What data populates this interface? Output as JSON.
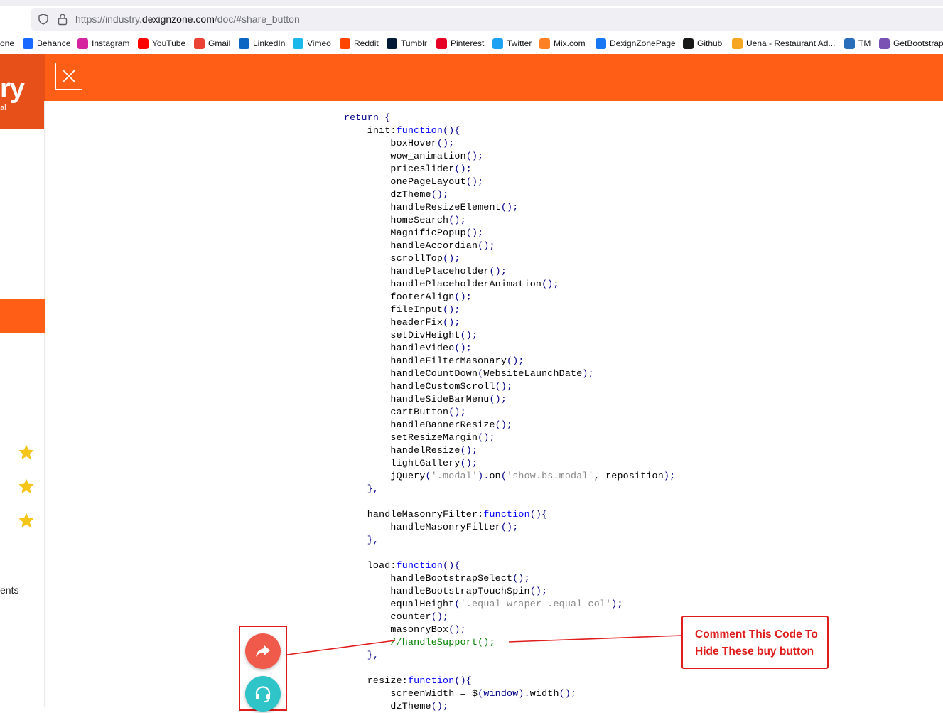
{
  "browser": {
    "url_prefix": "https://industry.",
    "url_domain": "dexignzone.com",
    "url_path": "/doc/#share_button"
  },
  "bookmarks": [
    {
      "label": "one",
      "icon": "none",
      "color": ""
    },
    {
      "label": "Behance",
      "icon": "behance-icon",
      "color": "#1769ff"
    },
    {
      "label": "Instagram",
      "icon": "instagram-icon",
      "color": "#d6249f"
    },
    {
      "label": "YouTube",
      "icon": "youtube-icon",
      "color": "#ff0000"
    },
    {
      "label": "Gmail",
      "icon": "gmail-icon",
      "color": "#ea4335"
    },
    {
      "label": "LinkedIn",
      "icon": "linkedin-icon",
      "color": "#0a66c2"
    },
    {
      "label": "Vimeo",
      "icon": "vimeo-icon",
      "color": "#1ab7ea"
    },
    {
      "label": "Reddit",
      "icon": "reddit-icon",
      "color": "#ff4500"
    },
    {
      "label": "Tumblr",
      "icon": "tumblr-icon",
      "color": "#001935"
    },
    {
      "label": "Pinterest",
      "icon": "pinterest-icon",
      "color": "#e60023"
    },
    {
      "label": "Twitter",
      "icon": "twitter-icon",
      "color": "#1da1f2"
    },
    {
      "label": "Mix.com",
      "icon": "mix-icon",
      "color": "#ff8126"
    },
    {
      "label": "DexignZonePage",
      "icon": "facebook-icon",
      "color": "#1877f2"
    },
    {
      "label": "Github",
      "icon": "github-icon",
      "color": "#181717"
    },
    {
      "label": "Uena - Restaurant Ad...",
      "icon": "uena-icon",
      "color": "#f6a623"
    },
    {
      "label": "TM",
      "icon": "tm-icon",
      "color": "#2a6ebb"
    },
    {
      "label": "GetBootstrap",
      "icon": "bootstrap-icon",
      "color": "#7952b3"
    }
  ],
  "sidebar": {
    "logo_text": "ry",
    "logo_sub": "al",
    "bottom_text": "ents"
  },
  "code_lines": [
    [
      {
        "t": "return",
        "c": "ret"
      },
      {
        "t": " {",
        "c": "pn"
      }
    ],
    [
      {
        "t": "    init:",
        "c": ""
      },
      {
        "t": "function",
        "c": "kw"
      },
      {
        "t": "(){",
        "c": "pn"
      }
    ],
    [
      {
        "t": "        boxHover",
        "c": ""
      },
      {
        "t": "();",
        "c": "pn"
      }
    ],
    [
      {
        "t": "        wow_animation",
        "c": ""
      },
      {
        "t": "();",
        "c": "pn"
      }
    ],
    [
      {
        "t": "        priceslider",
        "c": ""
      },
      {
        "t": "();",
        "c": "pn"
      }
    ],
    [
      {
        "t": "        onePageLayout",
        "c": ""
      },
      {
        "t": "();",
        "c": "pn"
      }
    ],
    [
      {
        "t": "        dzTheme",
        "c": ""
      },
      {
        "t": "();",
        "c": "pn"
      }
    ],
    [
      {
        "t": "        handleResizeElement",
        "c": ""
      },
      {
        "t": "();",
        "c": "pn"
      }
    ],
    [
      {
        "t": "        homeSearch",
        "c": ""
      },
      {
        "t": "();",
        "c": "pn"
      }
    ],
    [
      {
        "t": "        MagnificPopup",
        "c": ""
      },
      {
        "t": "();",
        "c": "pn"
      }
    ],
    [
      {
        "t": "        handleAccordian",
        "c": ""
      },
      {
        "t": "();",
        "c": "pn"
      }
    ],
    [
      {
        "t": "        scrollTop",
        "c": ""
      },
      {
        "t": "();",
        "c": "pn"
      }
    ],
    [
      {
        "t": "        handlePlaceholder",
        "c": ""
      },
      {
        "t": "();",
        "c": "pn"
      }
    ],
    [
      {
        "t": "        handlePlaceholderAnimation",
        "c": ""
      },
      {
        "t": "();",
        "c": "pn"
      }
    ],
    [
      {
        "t": "        footerAlign",
        "c": ""
      },
      {
        "t": "();",
        "c": "pn"
      }
    ],
    [
      {
        "t": "        fileInput",
        "c": ""
      },
      {
        "t": "();",
        "c": "pn"
      }
    ],
    [
      {
        "t": "        headerFix",
        "c": ""
      },
      {
        "t": "();",
        "c": "pn"
      }
    ],
    [
      {
        "t": "        setDivHeight",
        "c": ""
      },
      {
        "t": "();",
        "c": "pn"
      }
    ],
    [
      {
        "t": "        handleVideo",
        "c": ""
      },
      {
        "t": "();",
        "c": "pn"
      }
    ],
    [
      {
        "t": "        handleFilterMasonary",
        "c": ""
      },
      {
        "t": "();",
        "c": "pn"
      }
    ],
    [
      {
        "t": "        handleCountDown",
        "c": ""
      },
      {
        "t": "(",
        "c": "pn"
      },
      {
        "t": "WebsiteLaunchDate",
        "c": ""
      },
      {
        "t": ");",
        "c": "pn"
      }
    ],
    [
      {
        "t": "        handleCustomScroll",
        "c": ""
      },
      {
        "t": "();",
        "c": "pn"
      }
    ],
    [
      {
        "t": "        handleSideBarMenu",
        "c": ""
      },
      {
        "t": "();",
        "c": "pn"
      }
    ],
    [
      {
        "t": "        cartButton",
        "c": ""
      },
      {
        "t": "();",
        "c": "pn"
      }
    ],
    [
      {
        "t": "        handleBannerResize",
        "c": ""
      },
      {
        "t": "();",
        "c": "pn"
      }
    ],
    [
      {
        "t": "        setResizeMargin",
        "c": ""
      },
      {
        "t": "();",
        "c": "pn"
      }
    ],
    [
      {
        "t": "        handelResize",
        "c": ""
      },
      {
        "t": "();",
        "c": "pn"
      }
    ],
    [
      {
        "t": "        lightGallery",
        "c": ""
      },
      {
        "t": "();",
        "c": "pn"
      }
    ],
    [
      {
        "t": "        jQuery",
        "c": ""
      },
      {
        "t": "(",
        "c": "pn"
      },
      {
        "t": "'.modal'",
        "c": "str"
      },
      {
        "t": ").",
        "c": "pn"
      },
      {
        "t": "on",
        "c": ""
      },
      {
        "t": "(",
        "c": "pn"
      },
      {
        "t": "'show.bs.modal'",
        "c": "str"
      },
      {
        "t": ", reposition",
        "c": ""
      },
      {
        "t": ");",
        "c": "pn"
      }
    ],
    [
      {
        "t": "    },",
        "c": "pn"
      }
    ],
    [
      {
        "t": "",
        "c": ""
      }
    ],
    [
      {
        "t": "    handleMasonryFilter:",
        "c": ""
      },
      {
        "t": "function",
        "c": "kw"
      },
      {
        "t": "(){",
        "c": "pn"
      }
    ],
    [
      {
        "t": "        handleMasonryFilter",
        "c": ""
      },
      {
        "t": "();",
        "c": "pn"
      }
    ],
    [
      {
        "t": "    },",
        "c": "pn"
      }
    ],
    [
      {
        "t": "",
        "c": ""
      }
    ],
    [
      {
        "t": "    load:",
        "c": ""
      },
      {
        "t": "function",
        "c": "kw"
      },
      {
        "t": "(){",
        "c": "pn"
      }
    ],
    [
      {
        "t": "        handleBootstrapSelect",
        "c": ""
      },
      {
        "t": "();",
        "c": "pn"
      }
    ],
    [
      {
        "t": "        handleBootstrapTouchSpin",
        "c": ""
      },
      {
        "t": "();",
        "c": "pn"
      }
    ],
    [
      {
        "t": "        equalHeight",
        "c": ""
      },
      {
        "t": "(",
        "c": "pn"
      },
      {
        "t": "'.equal-wraper .equal-col'",
        "c": "str"
      },
      {
        "t": ");",
        "c": "pn"
      }
    ],
    [
      {
        "t": "        counter",
        "c": ""
      },
      {
        "t": "();",
        "c": "pn"
      }
    ],
    [
      {
        "t": "        masonryBox",
        "c": ""
      },
      {
        "t": "();",
        "c": "pn"
      }
    ],
    [
      {
        "t": "        //handleSupport();",
        "c": "cm"
      }
    ],
    [
      {
        "t": "    },",
        "c": "pn"
      }
    ],
    [
      {
        "t": "",
        "c": ""
      }
    ],
    [
      {
        "t": "    resize:",
        "c": ""
      },
      {
        "t": "function",
        "c": "kw"
      },
      {
        "t": "(){",
        "c": "pn"
      }
    ],
    [
      {
        "t": "        screenWidth = $",
        "c": ""
      },
      {
        "t": "(",
        "c": "pn"
      },
      {
        "t": "window",
        "c": "var"
      },
      {
        "t": ").",
        "c": "pn"
      },
      {
        "t": "width",
        "c": ""
      },
      {
        "t": "();",
        "c": "pn"
      }
    ],
    [
      {
        "t": "        dzTheme",
        "c": ""
      },
      {
        "t": "();",
        "c": "pn"
      }
    ]
  ],
  "annotation": {
    "line1": "Comment This Code To",
    "line2": "Hide These buy button"
  },
  "colors": {
    "brand_orange": "#fe5e16",
    "annotation_red": "#e01c1c",
    "share_button": "#f05a4a",
    "support_button": "#2ec4c8"
  }
}
